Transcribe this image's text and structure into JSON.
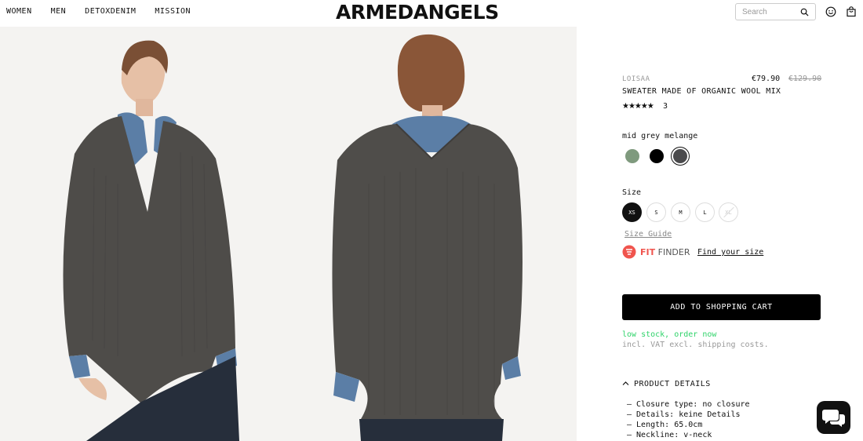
{
  "nav": {
    "items": [
      "WOMEN",
      "MEN",
      "DETOXDENIM",
      "MISSION"
    ]
  },
  "logo": "ARMEDANGELS",
  "search": {
    "placeholder": "Search"
  },
  "icons": {
    "search": "search-icon",
    "account": "smiley-account-icon",
    "cart": "shopping-bag-icon",
    "chat": "chat-bubbles-icon",
    "chevron": "chevron-up-icon"
  },
  "product": {
    "brand": "LOISAA",
    "name": "SWEATER MADE OF ORGANIC WOOL MIX",
    "price": "€79.90",
    "old_price": "€129.90",
    "stars": "★★★★★",
    "rating": 5,
    "review_count": "3",
    "color_name": "mid grey melange",
    "colors": [
      "#7f9a7e",
      "#000000",
      "#4a4a4c"
    ],
    "selected_color": 2,
    "size_label": "Size",
    "sizes": [
      "XS",
      "S",
      "M",
      "L",
      "XL"
    ],
    "selected_size": "XS",
    "unavailable_size": "XL",
    "size_guide": "Size Guide",
    "fit_finder": {
      "brand_bold": "FIT",
      "brand_rest": "FINDER",
      "link": "Find your size"
    },
    "cart_button": "ADD TO SHOPPING CART",
    "stock": "low stock, order now",
    "vat": "incl. VAT excl. shipping costs.",
    "details_title": "PRODUCT DETAILS",
    "details": [
      "– Closure type: no closure",
      "– Details: keine Details",
      "– Length: 65.0cm",
      "– Neckline: v-neck"
    ]
  },
  "colors": {
    "accent_green": "#2fd36a",
    "fit_red": "#f0554e"
  }
}
